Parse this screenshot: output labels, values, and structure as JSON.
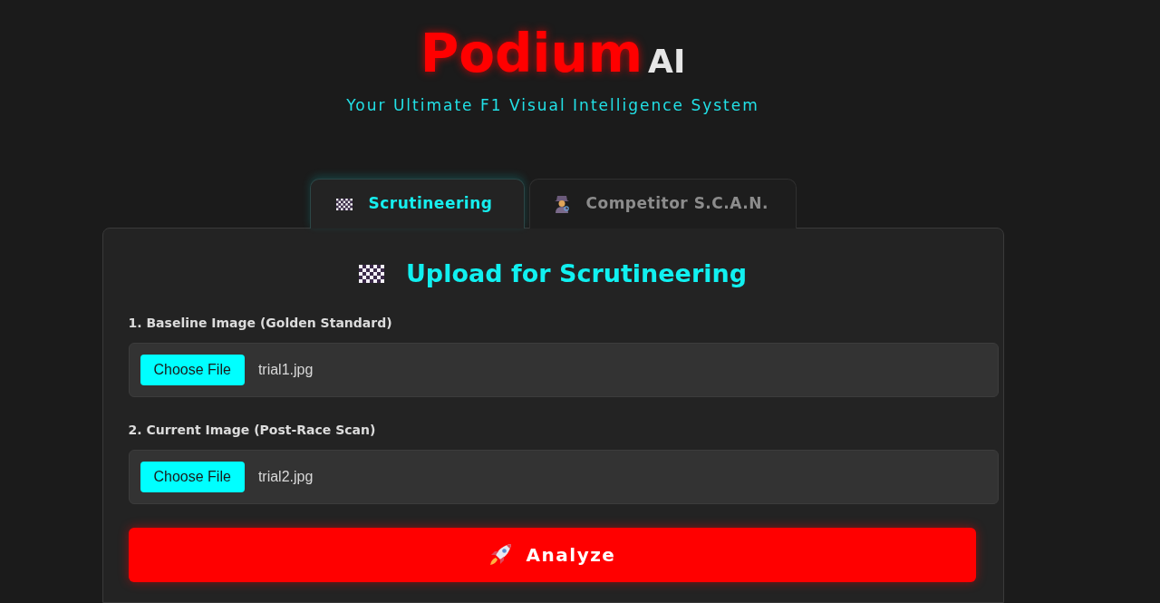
{
  "header": {
    "brand": "Podium",
    "brand_suffix": "AI",
    "tagline": "Your Ultimate F1 Visual Intelligence System"
  },
  "tabs": [
    {
      "label": "Scrutineering",
      "selected": true
    },
    {
      "label": "Competitor S.C.A.N.",
      "selected": false
    }
  ],
  "panel": {
    "heading": "Upload for Scrutineering",
    "fields": [
      {
        "label": "1. Baseline Image (Golden Standard)",
        "button": "Choose File",
        "value": "trial1.jpg"
      },
      {
        "label": "2. Current Image (Post-Race Scan)",
        "button": "Choose File",
        "value": "trial2.jpg"
      }
    ],
    "submit": "Analyze"
  }
}
